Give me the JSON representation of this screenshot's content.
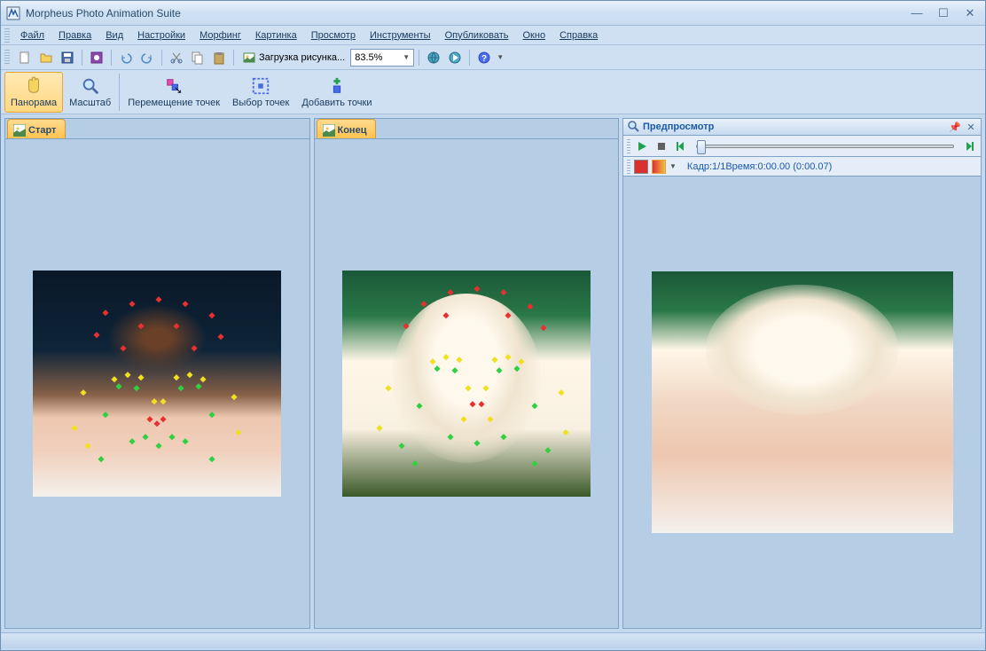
{
  "titlebar": {
    "title": "Morpheus Photo Animation Suite"
  },
  "menu": {
    "file": "Файл",
    "edit": "Правка",
    "view": "Вид",
    "settings": "Настройки",
    "morph": "Морфинг",
    "picture": "Картинка",
    "preview": "Просмотр",
    "tools": "Инструменты",
    "publish": "Опубликовать",
    "window": "Окно",
    "help": "Справка"
  },
  "toolbar1": {
    "load_image": "Загрузка рисунка...",
    "zoom": "83.5%"
  },
  "tools": {
    "panorama": "Панорама",
    "zoom": "Масштаб",
    "move_points": "Перемещение точек",
    "select_points": "Выбор точек",
    "add_points": "Добавить точки"
  },
  "panels": {
    "start": "Старт",
    "end": "Конец"
  },
  "preview": {
    "title": "Предпросмотр",
    "frame_info": "Кадр:1/1Время:0:00.00 (0:00.07)"
  }
}
